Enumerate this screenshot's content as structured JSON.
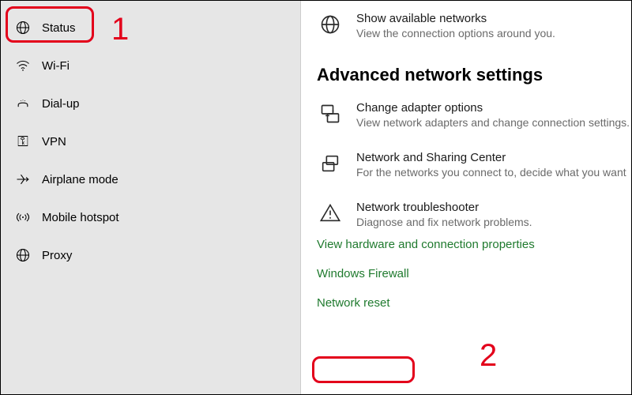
{
  "sidebar": {
    "items": [
      {
        "label": "Status"
      },
      {
        "label": "Wi-Fi"
      },
      {
        "label": "Dial-up"
      },
      {
        "label": "VPN"
      },
      {
        "label": "Airplane mode"
      },
      {
        "label": "Mobile hotspot"
      },
      {
        "label": "Proxy"
      }
    ]
  },
  "main": {
    "show_networks": {
      "title": "Show available networks",
      "desc": "View the connection options around you."
    },
    "section_heading": "Advanced network settings",
    "adapter": {
      "title": "Change adapter options",
      "desc": "View network adapters and change connection settings."
    },
    "sharing": {
      "title": "Network and Sharing Center",
      "desc": "For the networks you connect to, decide what you want"
    },
    "troubleshooter": {
      "title": "Network troubleshooter",
      "desc": "Diagnose and fix network problems."
    },
    "links": {
      "hardware": "View hardware and connection properties",
      "firewall": "Windows Firewall",
      "reset": "Network reset"
    }
  },
  "annotations": {
    "one": "1",
    "two": "2"
  }
}
